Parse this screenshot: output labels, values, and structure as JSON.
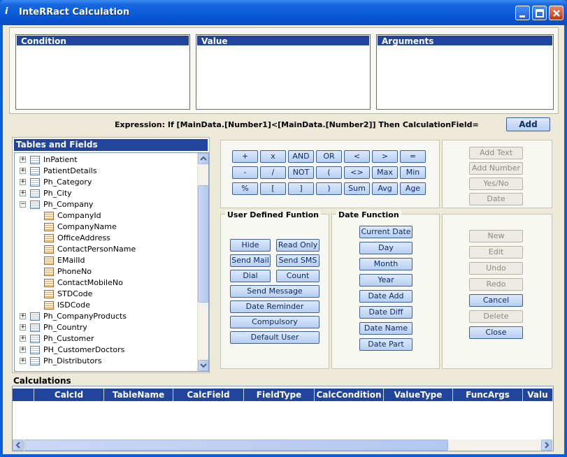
{
  "window": {
    "title": "InteRRact Calculation",
    "app_glyph": "i"
  },
  "top_lists": [
    {
      "header": "Condition"
    },
    {
      "header": "Value"
    },
    {
      "header": "Arguments"
    }
  ],
  "expression": "Expression: If [MainData.[Number1]<[MainData.[Number2]] Then CalculationField=",
  "add_label": "Add",
  "operators": [
    [
      "+",
      "x",
      "AND",
      "OR",
      "<",
      ">",
      "="
    ],
    [
      "-",
      "/",
      "NOT",
      "(",
      "<>",
      "Max",
      "Min"
    ],
    [
      "%",
      "[",
      "]",
      ")",
      "Sum",
      "Avg",
      "Age"
    ]
  ],
  "side_buttons": [
    "Add Text",
    "Add Number",
    "Yes/No",
    "Date"
  ],
  "udf": {
    "title": "User Defined Funtion",
    "pairs": [
      [
        "Hide",
        "Read Only"
      ],
      [
        "Send Mail",
        "Send SMS"
      ],
      [
        "Dial",
        "Count"
      ]
    ],
    "wide": [
      "Send Message",
      "Date Reminder",
      "Compulsory",
      "Default User"
    ]
  },
  "date_fn": {
    "title": "Date Function",
    "items": [
      "Current Date",
      "Day",
      "Month",
      "Year",
      "Date Add",
      "Date Diff",
      "Date Name",
      "Date Part"
    ]
  },
  "actions": [
    {
      "label": "New",
      "enabled": false
    },
    {
      "label": "Edit",
      "enabled": false
    },
    {
      "label": "Undo",
      "enabled": false
    },
    {
      "label": "Redo",
      "enabled": false
    },
    {
      "label": "Cancel",
      "enabled": true
    },
    {
      "label": "Delete",
      "enabled": false
    },
    {
      "label": "Close",
      "enabled": true
    }
  ],
  "tree": {
    "title": "Tables and Fields",
    "rows": [
      {
        "label": "InPatient",
        "kind": "table",
        "expanded": false
      },
      {
        "label": "PatientDetails",
        "kind": "table",
        "expanded": false
      },
      {
        "label": "Ph_Category",
        "kind": "table",
        "expanded": false
      },
      {
        "label": "Ph_City",
        "kind": "table",
        "expanded": false
      },
      {
        "label": "Ph_Company",
        "kind": "table",
        "expanded": true
      },
      {
        "label": "CompanyId",
        "kind": "field"
      },
      {
        "label": "CompanyName",
        "kind": "field"
      },
      {
        "label": "OfficeAddress",
        "kind": "field"
      },
      {
        "label": "ContactPersonName",
        "kind": "field"
      },
      {
        "label": "EMailId",
        "kind": "field"
      },
      {
        "label": "PhoneNo",
        "kind": "field"
      },
      {
        "label": "ContactMobileNo",
        "kind": "field"
      },
      {
        "label": "STDCode",
        "kind": "field"
      },
      {
        "label": "ISDCode",
        "kind": "field"
      },
      {
        "label": "Ph_CompanyProducts",
        "kind": "table",
        "expanded": false
      },
      {
        "label": "Ph_Country",
        "kind": "table",
        "expanded": false
      },
      {
        "label": "Ph_Customer",
        "kind": "table",
        "expanded": false
      },
      {
        "label": "PH_CustomerDoctors",
        "kind": "table",
        "expanded": false
      },
      {
        "label": "Ph_Distributors",
        "kind": "table",
        "expanded": false
      }
    ]
  },
  "calculations": {
    "title": "Calculations",
    "columns": [
      "CalcId",
      "TableName",
      "CalcField",
      "FieldType",
      "CalcCondition",
      "ValueType",
      "FuncArgs",
      "Valu"
    ]
  }
}
